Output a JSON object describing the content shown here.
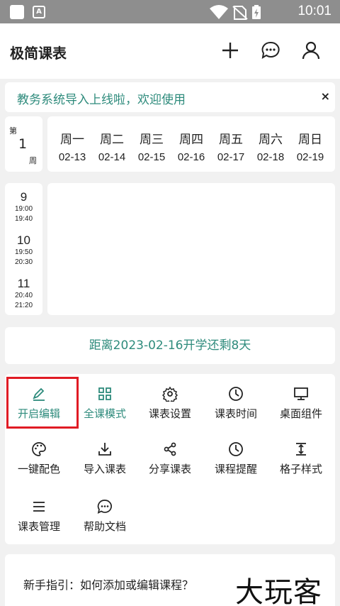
{
  "status_bar": {
    "time": "10:01",
    "icons": [
      "app-square-icon",
      "a-icon",
      "wifi-icon",
      "no-sim-icon",
      "battery-charging-icon"
    ]
  },
  "app_bar": {
    "title": "极简课表",
    "actions": [
      "add-icon",
      "chat-icon",
      "user-icon"
    ]
  },
  "banner": {
    "text": "教务系统导入上线啦，欢迎使用",
    "close": "×"
  },
  "week": {
    "prefix": "第",
    "number": "1",
    "suffix": "周"
  },
  "days": [
    {
      "name": "周一",
      "date": "02-13"
    },
    {
      "name": "周二",
      "date": "02-14"
    },
    {
      "name": "周三",
      "date": "02-15"
    },
    {
      "name": "周四",
      "date": "02-16"
    },
    {
      "name": "周五",
      "date": "02-17"
    },
    {
      "name": "周六",
      "date": "02-18"
    },
    {
      "name": "周日",
      "date": "02-19"
    }
  ],
  "slots": [
    {
      "num": "9",
      "start": "19:00",
      "end": "19:40"
    },
    {
      "num": "10",
      "start": "19:50",
      "end": "20:30"
    },
    {
      "num": "11",
      "start": "20:40",
      "end": "21:20"
    }
  ],
  "countdown": "距离2023-02-16开学还剩8天",
  "menu": [
    {
      "label": "开启编辑",
      "icon": "pencil-icon"
    },
    {
      "label": "全课模式",
      "icon": "grid-icon"
    },
    {
      "label": "课表设置",
      "icon": "gear-icon"
    },
    {
      "label": "课表时间",
      "icon": "clock-icon"
    },
    {
      "label": "桌面组件",
      "icon": "monitor-icon"
    },
    {
      "label": "一键配色",
      "icon": "palette-icon"
    },
    {
      "label": "导入课表",
      "icon": "import-icon"
    },
    {
      "label": "分享课表",
      "icon": "share-icon"
    },
    {
      "label": "课程提醒",
      "icon": "clock-icon"
    },
    {
      "label": "格子样式",
      "icon": "height-icon"
    },
    {
      "label": "课表管理",
      "icon": "list-icon"
    },
    {
      "label": "帮助文档",
      "icon": "help-chat-icon"
    }
  ],
  "guide": {
    "text": "新手指引：如何添加或编辑课程？"
  },
  "watermark": "大玩客",
  "colors": {
    "accent": "#2e8b7c",
    "highlight": "#e01b24",
    "status_bar": "#8e8e8e"
  }
}
